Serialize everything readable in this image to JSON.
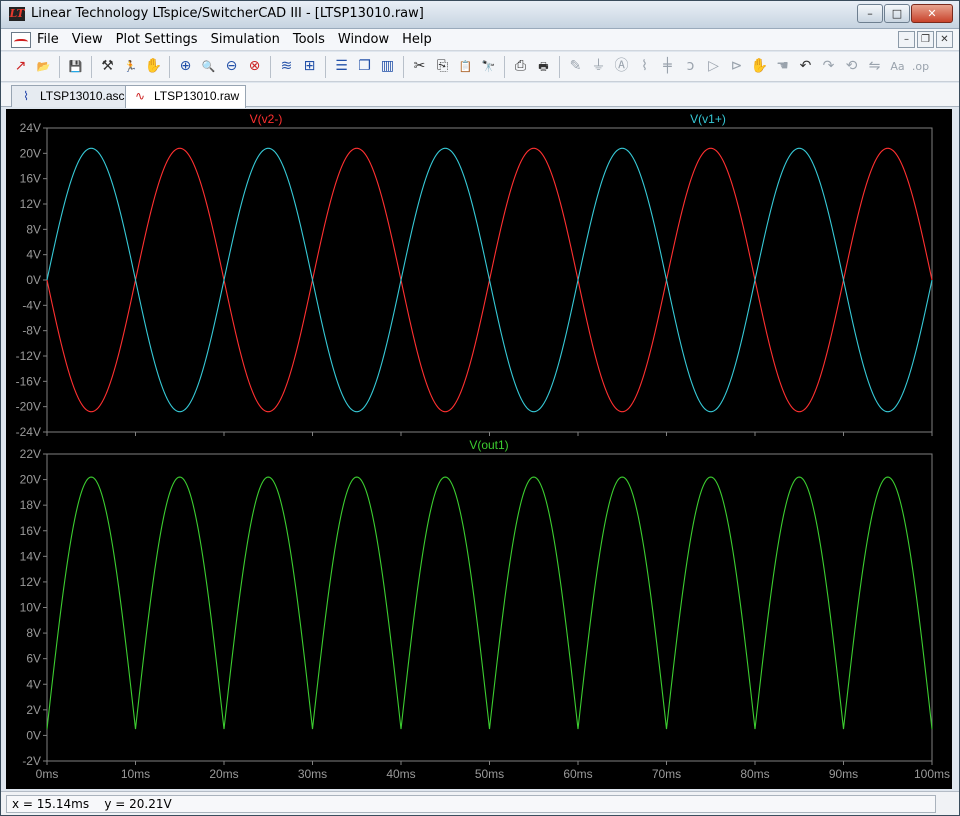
{
  "window": {
    "title": "Linear Technology LTspice/SwitcherCAD III - [LTSP13010.raw]",
    "app_icon_glyph": "LT",
    "controls": {
      "minimize": "–",
      "maximize": "□",
      "close": "✕"
    },
    "mdi_controls": {
      "minimize": "–",
      "restore": "❐",
      "close": "✕"
    }
  },
  "menubar": {
    "items": [
      "File",
      "View",
      "Plot Settings",
      "Simulation",
      "Tools",
      "Window",
      "Help"
    ]
  },
  "toolbar": {
    "icons": [
      "new-schematic-icon",
      "open-folder-icon",
      "sep",
      "save-icon",
      "sep",
      "control-panel-icon",
      "run-icon",
      "pan-hand-icon",
      "sep",
      "zoom-in-icon",
      "zoom-full-icon",
      "zoom-out-icon",
      "cancel-zoom-icon",
      "sep",
      "autorange-icon",
      "mark-icon",
      "sep",
      "tile-horizontal-icon",
      "cascade-icon",
      "tile-vertical-icon",
      "sep",
      "cut-icon",
      "copy-icon",
      "paste-icon",
      "find-icon",
      "sep",
      "print-preview-icon",
      "print-icon",
      "sep",
      "wire-icon",
      "ground-icon",
      "label-icon",
      "resistor-icon",
      "capacitor-icon",
      "inductor-icon",
      "diode-icon",
      "component-icon",
      "move-icon",
      "drag-icon",
      "undo-icon",
      "redo-icon",
      "rotate-icon",
      "mirror-icon",
      "text-icon",
      "spice-directive-icon"
    ]
  },
  "tabs": [
    {
      "label": "LTSP13010.asc",
      "icon": "schematic-icon",
      "active": false
    },
    {
      "label": "LTSP13010.raw",
      "icon": "waveform-icon",
      "active": true
    }
  ],
  "status": {
    "cursor": "x = 15.14ms    y = 20.21V"
  },
  "colors": {
    "v2_minus": "#ff3030",
    "v1_plus": "#36c9d6",
    "out1": "#3ccd30",
    "axis_text": "#9a9a9a",
    "grid_box": "#808080"
  },
  "chart_data": [
    {
      "type": "line",
      "series": [
        {
          "name": "V(v2-)",
          "color": "#ff3030",
          "amplitude": 20.8,
          "frequency_hz": 50,
          "phase": "inverted"
        },
        {
          "name": "V(v1+)",
          "color": "#36c9d6",
          "amplitude": 20.8,
          "frequency_hz": 50,
          "phase": "normal"
        }
      ],
      "x_unit": "ms",
      "xlim": [
        0,
        100
      ],
      "ylim": [
        -24,
        24
      ],
      "yticks": [
        "24V",
        "20V",
        "16V",
        "12V",
        "8V",
        "4V",
        "0V",
        "-4V",
        "-8V",
        "-12V",
        "-16V",
        "-20V",
        "-24V"
      ],
      "ytick_values": [
        24,
        20,
        16,
        12,
        8,
        4,
        0,
        -4,
        -8,
        -12,
        -16,
        -20,
        -24
      ]
    },
    {
      "type": "line",
      "series": [
        {
          "name": "V(out1)",
          "color": "#3ccd30",
          "amplitude": 20.2,
          "frequency_hz": 100,
          "shape": "full-wave rectified",
          "min": 0.5
        }
      ],
      "x_unit": "ms",
      "xlim": [
        0,
        100
      ],
      "ylim": [
        -2,
        22
      ],
      "yticks": [
        "22V",
        "20V",
        "18V",
        "16V",
        "14V",
        "12V",
        "10V",
        "8V",
        "6V",
        "4V",
        "2V",
        "0V",
        "-2V"
      ],
      "ytick_values": [
        22,
        20,
        18,
        16,
        14,
        12,
        10,
        8,
        6,
        4,
        2,
        0,
        -2
      ],
      "xticks": [
        "0ms",
        "10ms",
        "20ms",
        "30ms",
        "40ms",
        "50ms",
        "60ms",
        "70ms",
        "80ms",
        "90ms",
        "100ms"
      ],
      "xtick_values": [
        0,
        10,
        20,
        30,
        40,
        50,
        60,
        70,
        80,
        90,
        100
      ]
    }
  ]
}
